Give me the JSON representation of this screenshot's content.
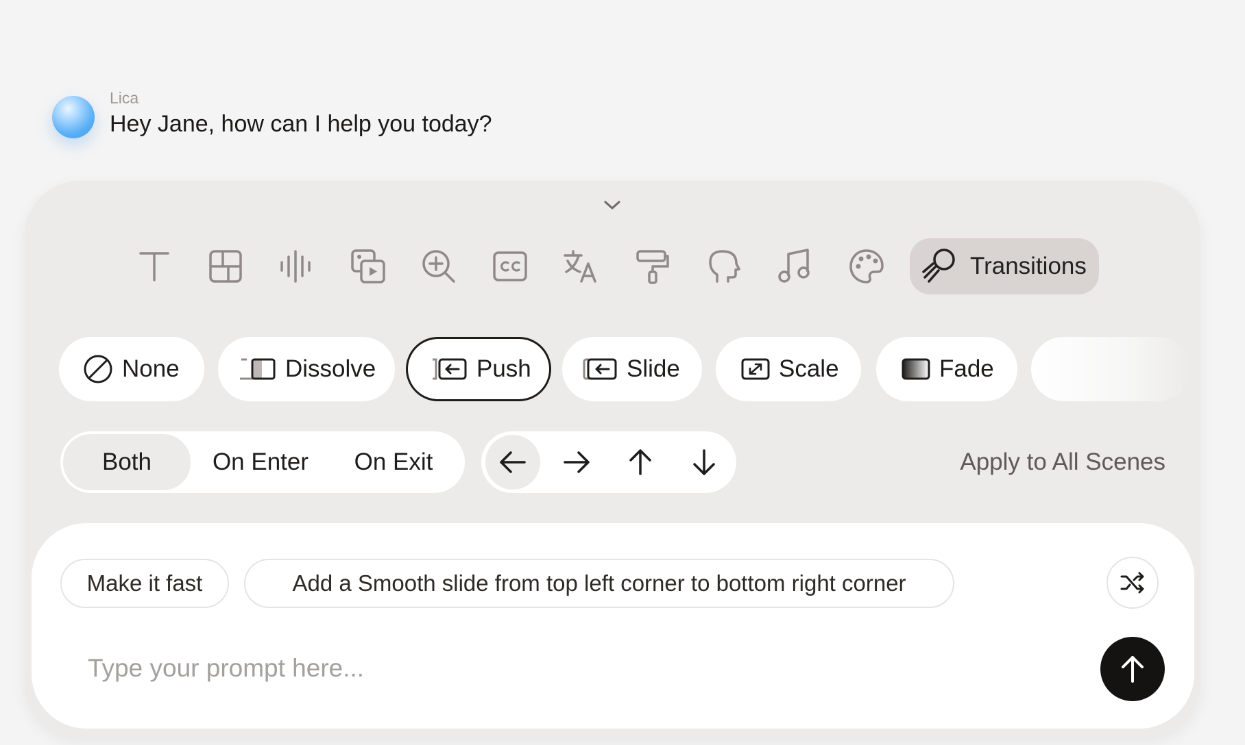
{
  "assistant": {
    "name": "Lica",
    "message": "Hey Jane, how can I help you today?"
  },
  "toolbar": {
    "tools": [
      "text-icon",
      "layout-icon",
      "audio-waveform-icon",
      "media-icon",
      "zoom-in-icon",
      "captions-icon",
      "translate-icon",
      "paint-roller-icon",
      "head-icon",
      "music-icon",
      "palette-icon"
    ],
    "active_label": "Transitions",
    "active_icon": "transitions-icon"
  },
  "transitions": {
    "options": [
      "None",
      "Dissolve",
      "Push",
      "Slide",
      "Scale",
      "Fade"
    ],
    "selected": "Push"
  },
  "apply_mode": {
    "options": [
      "Both",
      "On Enter",
      "On Exit"
    ],
    "selected": "Both"
  },
  "direction": {
    "options": [
      "arrow-left-icon",
      "arrow-right-icon",
      "arrow-up-icon",
      "arrow-down-icon"
    ],
    "selected": "arrow-left-icon"
  },
  "apply_all_label": "Apply to All Scenes",
  "suggestions": [
    "Make it fast",
    "Add a Smooth slide from top left corner to bottom right corner"
  ],
  "prompt": {
    "placeholder": "Type your prompt here...",
    "value": ""
  },
  "colors": {
    "background": "#f4f4f4",
    "panel": "#ecebea",
    "active_tool": "#d9d4d1",
    "send_button": "#141312"
  }
}
